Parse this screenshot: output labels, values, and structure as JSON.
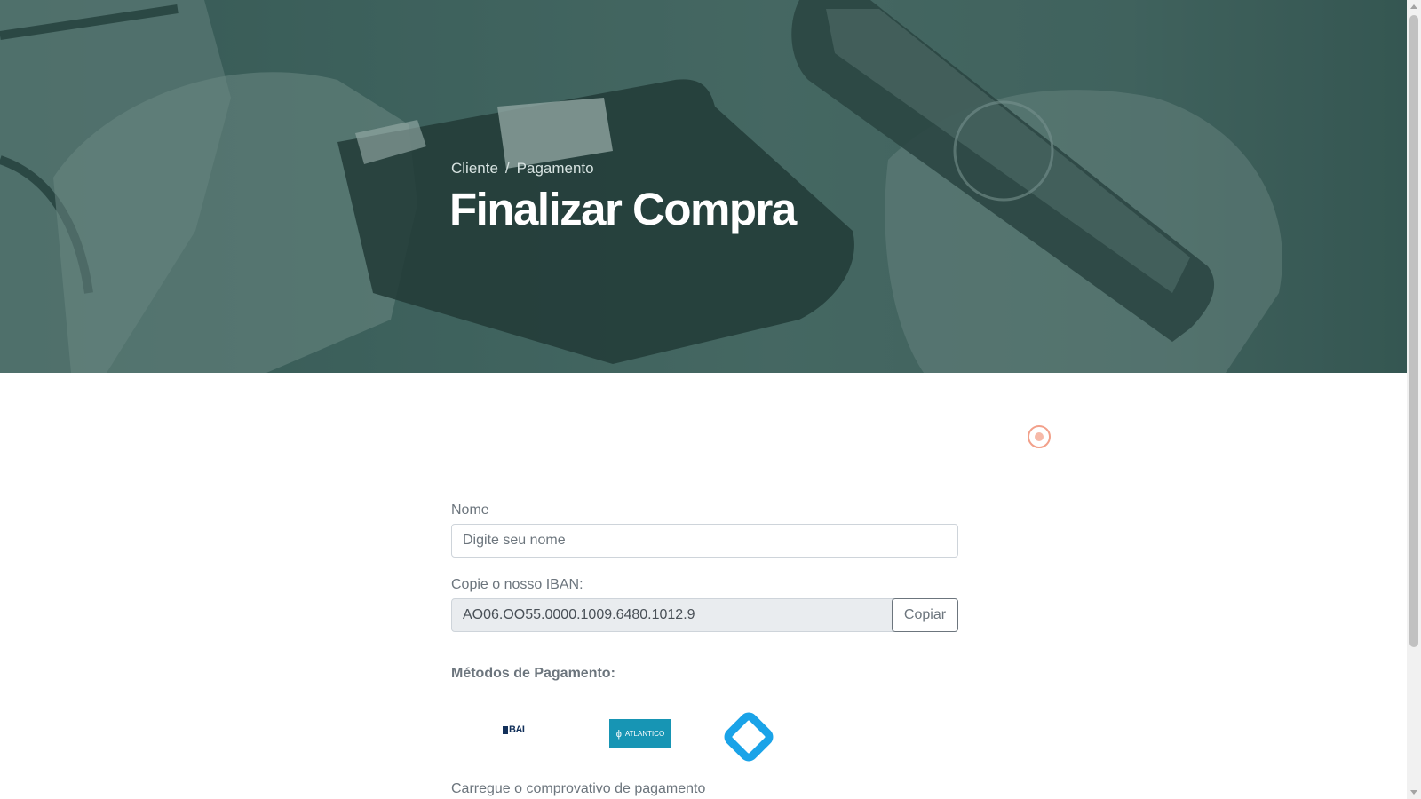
{
  "hero": {
    "breadcrumb": {
      "home": "Cliente",
      "separator": "/",
      "current": "Pagamento"
    },
    "title": "Finalizar Compra"
  },
  "form": {
    "name_label": "Nome",
    "name_placeholder": "Digite seu nome",
    "iban_label": "Copie o nosso IBAN:",
    "iban_value": "AO06.OO55.0000.1009.6480.1012.9",
    "copy_label": "Copiar",
    "methods_title": "Métodos de Pagamento:",
    "methods": [
      {
        "name": "BAI"
      },
      {
        "name": "ATLANTICO"
      },
      {
        "name": "diamond-logo"
      }
    ],
    "upload_label": "Carregue o comprovativo de pagamento"
  },
  "colors": {
    "hero_tint": "#4a6b67",
    "loader": "#f2a08a",
    "atlantico": "#1795b4",
    "bai": "#12305a",
    "diamond_logo": "#1aa3e8"
  }
}
